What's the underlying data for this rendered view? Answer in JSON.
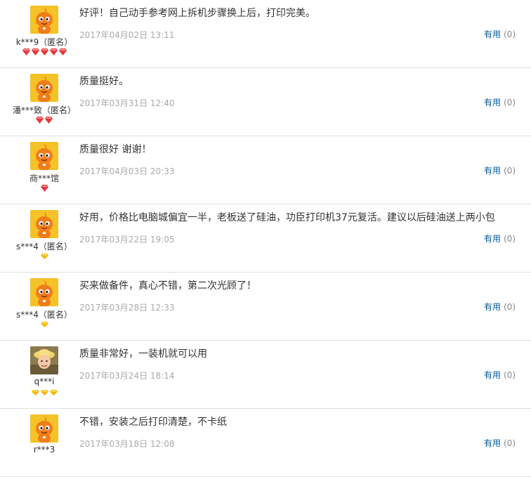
{
  "useful_label": "有用",
  "reviews": [
    {
      "user": "k***9（匿名）",
      "content": "好评！自己动手参考网上拆机步骤换上后，打印完美。",
      "date": "2017年04月02日 13:11",
      "useful_count": "(0)",
      "avatar": "default-mascot",
      "badges": {
        "type": "red-diamond",
        "count": 5
      }
    },
    {
      "user": "潘***致（匿名）",
      "content": "质量挺好。",
      "date": "2017年03月31日 12:40",
      "useful_count": "(0)",
      "avatar": "default-mascot",
      "badges": {
        "type": "red-diamond",
        "count": 2
      }
    },
    {
      "user": "商***馆",
      "content": "质量很好 谢谢！",
      "date": "2017年04月03日 20:33",
      "useful_count": "(0)",
      "avatar": "default-mascot",
      "badges": {
        "type": "red-diamond",
        "count": 1
      }
    },
    {
      "user": "s***4（匿名）",
      "content": "好用，价格比电脑城偏宜一半，老板送了硅油，功臣打印机37元复活。建议以后硅油送上两小包",
      "date": "2017年03月22日 19:05",
      "useful_count": "(0)",
      "avatar": "default-mascot",
      "badges": {
        "type": "gold-diamond",
        "count": 1
      }
    },
    {
      "user": "s***4（匿名）",
      "content": "买来做备件，真心不错，第二次光顾了！",
      "date": "2017年03月28日 12:33",
      "useful_count": "(0)",
      "avatar": "default-mascot",
      "badges": {
        "type": "gold-diamond",
        "count": 1
      }
    },
    {
      "user": "q***i",
      "content": "质量非常好，一装机就可以用",
      "date": "2017年03月24日 18:14",
      "useful_count": "(0)",
      "avatar": "child-photo",
      "badges": {
        "type": "gold-diamond",
        "count": 3
      }
    },
    {
      "user": "r***3",
      "content": "不错，安装之后打印清楚，不卡纸",
      "date": "2017年03月18日 12:08",
      "useful_count": "(0)",
      "avatar": "default-mascot",
      "badges": {
        "type": "gold-diamond",
        "count": 0
      }
    }
  ],
  "colors": {
    "link_blue": "#005aa0",
    "muted_gray": "#aaaaaa",
    "divider": "#e0e0e0",
    "red_diamond": "#e4393c",
    "gold_diamond": "#f5b800",
    "avatar_bg": "#f5c227",
    "mascot": "#f07c1a"
  }
}
